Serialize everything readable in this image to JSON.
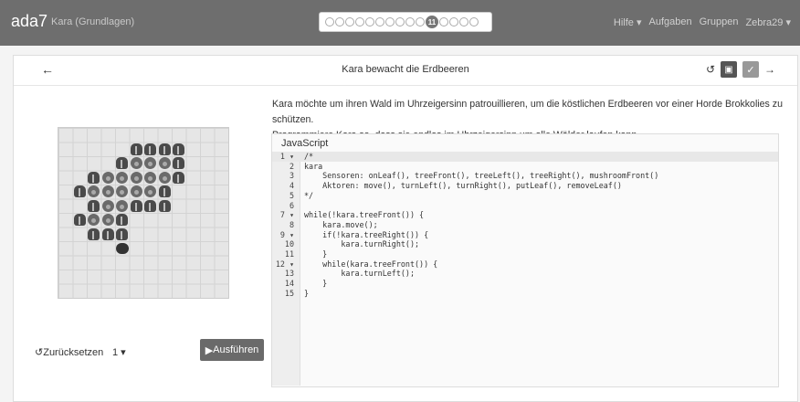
{
  "nav": {
    "brand": "ada7",
    "subtitle": "Kara (Grundlagen)",
    "progress_total": 15,
    "progress_current_label": "11",
    "links": [
      "Hilfe ▾",
      "Aufgaben",
      "Gruppen",
      "Zebra29 ▾"
    ]
  },
  "task": {
    "title": "Kara bewacht die Erdbeeren",
    "description_line1": "Kara möchte um ihren Wald im Uhrzeigersinn patrouillieren, um die köstlichen Erdbeeren vor einer Horde Brokkolies zu schützen.",
    "description_line2": "Programmiere Kara so, dass sie endlos im Uhrzeigersinn um alle Wälder laufen kann."
  },
  "controls": {
    "reset_label": "Zurücksetzen",
    "speed_value": "1 ▾",
    "run_label": "Ausführen"
  },
  "editor": {
    "language_label": "JavaScript",
    "line_numbers": [
      "1 ▾",
      "2",
      "3",
      "4",
      "5",
      "6",
      "7 ▾",
      "8",
      "9 ▾",
      "10",
      "11",
      "12 ▾",
      "13",
      "14",
      "15"
    ],
    "code_lines": [
      "/*",
      "kara",
      "    Sensoren: onLeaf(), treeFront(), treeLeft(), treeRight(), mushroomFront()",
      "    Aktoren: move(), turnLeft(), turnRight(), putLeaf(), removeLeaf()",
      "*/",
      "",
      "while(!kara.treeFront()) {",
      "    kara.move();",
      "    if(!kara.treeRight()) {",
      "        kara.turnRight();",
      "    }",
      "    while(kara.treeFront()) {",
      "        kara.turnLeft();",
      "    }",
      "}"
    ]
  },
  "world": {
    "cells": [
      {
        "r": 1,
        "c": 5,
        "t": "tree"
      },
      {
        "r": 1,
        "c": 6,
        "t": "tree"
      },
      {
        "r": 1,
        "c": 7,
        "t": "tree"
      },
      {
        "r": 1,
        "c": 8,
        "t": "tree"
      },
      {
        "r": 2,
        "c": 4,
        "t": "tree"
      },
      {
        "r": 2,
        "c": 5,
        "t": "broc"
      },
      {
        "r": 2,
        "c": 6,
        "t": "broc"
      },
      {
        "r": 2,
        "c": 7,
        "t": "broc"
      },
      {
        "r": 2,
        "c": 8,
        "t": "tree"
      },
      {
        "r": 3,
        "c": 2,
        "t": "tree"
      },
      {
        "r": 3,
        "c": 3,
        "t": "broc"
      },
      {
        "r": 3,
        "c": 4,
        "t": "broc"
      },
      {
        "r": 3,
        "c": 5,
        "t": "broc"
      },
      {
        "r": 3,
        "c": 6,
        "t": "broc"
      },
      {
        "r": 3,
        "c": 7,
        "t": "broc"
      },
      {
        "r": 3,
        "c": 8,
        "t": "tree"
      },
      {
        "r": 4,
        "c": 1,
        "t": "tree"
      },
      {
        "r": 4,
        "c": 2,
        "t": "broc"
      },
      {
        "r": 4,
        "c": 3,
        "t": "broc"
      },
      {
        "r": 4,
        "c": 4,
        "t": "broc"
      },
      {
        "r": 4,
        "c": 5,
        "t": "broc"
      },
      {
        "r": 4,
        "c": 6,
        "t": "broc"
      },
      {
        "r": 4,
        "c": 7,
        "t": "tree"
      },
      {
        "r": 5,
        "c": 2,
        "t": "tree"
      },
      {
        "r": 5,
        "c": 3,
        "t": "broc"
      },
      {
        "r": 5,
        "c": 4,
        "t": "broc"
      },
      {
        "r": 5,
        "c": 5,
        "t": "tree"
      },
      {
        "r": 5,
        "c": 6,
        "t": "tree"
      },
      {
        "r": 5,
        "c": 7,
        "t": "tree"
      },
      {
        "r": 6,
        "c": 1,
        "t": "tree"
      },
      {
        "r": 6,
        "c": 2,
        "t": "broc"
      },
      {
        "r": 6,
        "c": 3,
        "t": "broc"
      },
      {
        "r": 6,
        "c": 4,
        "t": "tree"
      },
      {
        "r": 7,
        "c": 2,
        "t": "tree"
      },
      {
        "r": 7,
        "c": 3,
        "t": "tree"
      },
      {
        "r": 7,
        "c": 4,
        "t": "tree"
      }
    ],
    "kara": {
      "r": 8,
      "c": 4
    }
  }
}
